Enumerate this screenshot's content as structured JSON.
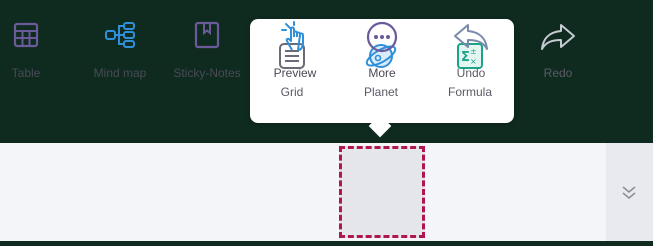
{
  "popup": {
    "items": [
      {
        "label": "Grid",
        "icon": "grid-icon"
      },
      {
        "label": "Planet",
        "icon": "planet-icon"
      },
      {
        "label": "Formula",
        "icon": "formula-icon"
      }
    ]
  },
  "toolbar": {
    "items": [
      {
        "label": "Table",
        "icon": "table-icon"
      },
      {
        "label": "Mind map",
        "icon": "mind-map-icon"
      },
      {
        "label": "Sticky-Notes",
        "icon": "sticky-notes-icon"
      },
      {
        "label": "Preview",
        "icon": "preview-icon"
      },
      {
        "label": "More",
        "icon": "more-icon",
        "selected": true
      },
      {
        "label": "Undo",
        "icon": "undo-icon"
      },
      {
        "label": "Redo",
        "icon": "redo-icon"
      }
    ],
    "expand_icon": "chevron-double-down-icon"
  },
  "colors": {
    "canvas": "#0f2b1f",
    "accent": "#2f8fd8",
    "icon_purple": "#6a5a9a",
    "highlight_border": "#b0174a",
    "formula_green": "#1aa58a"
  }
}
